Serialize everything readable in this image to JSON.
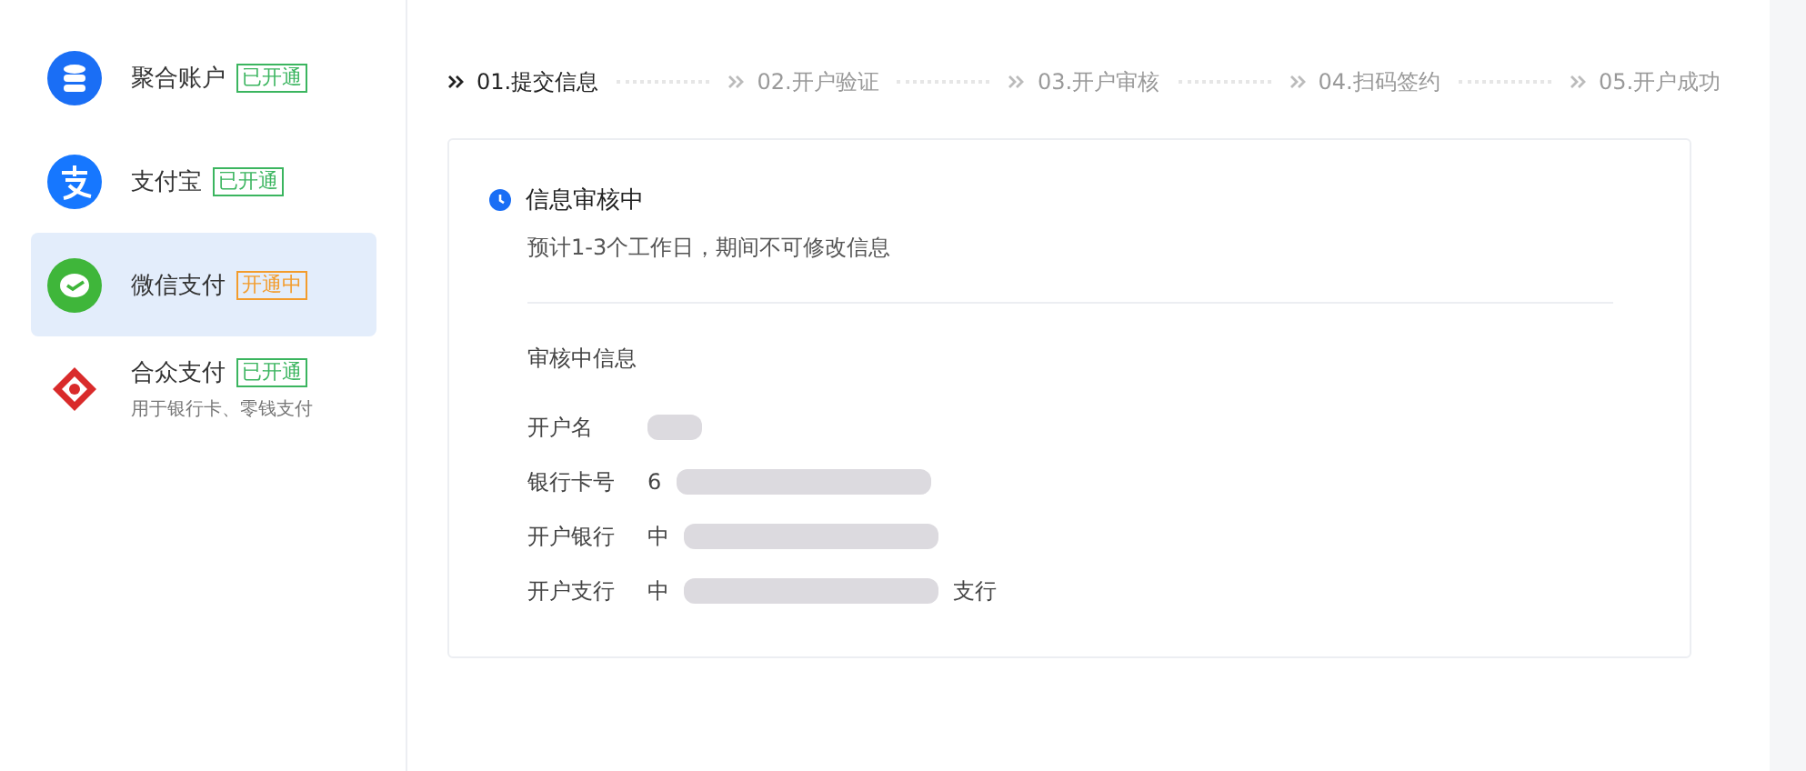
{
  "sidebar": {
    "items": [
      {
        "kind": "stack",
        "label": "聚合账户",
        "badge": "已开通",
        "color": "#3bb55f",
        "selected": false
      },
      {
        "kind": "alipay",
        "label": "支付宝",
        "badge": "已开通",
        "color": "#3bb55f",
        "selected": false
      },
      {
        "kind": "wechat",
        "label": "微信支付",
        "badge": "开通中",
        "color": "#f39c2c",
        "selected": true
      },
      {
        "kind": "bank",
        "label": "合众支付",
        "badge": "已开通",
        "color": "#3bb55f",
        "note": "用于银行卡、零钱支付",
        "selected": false
      }
    ]
  },
  "steps": [
    {
      "label": "01.提交信息",
      "selected": true
    },
    {
      "label": "02.开户验证",
      "selected": false
    },
    {
      "label": "03.开户审核",
      "selected": false
    },
    {
      "label": "04.扫码签约",
      "selected": false
    },
    {
      "label": "05.开户成功",
      "selected": false
    }
  ],
  "status": {
    "title": "信息审核中",
    "description": "预计1-3个工作日，期间不可修改信息"
  },
  "info": {
    "heading": "审核中信息",
    "fields": [
      {
        "label": "开户名",
        "redacted": true
      },
      {
        "label": "银行卡号",
        "value": "6",
        "redacted": true
      },
      {
        "label": "开户银行",
        "value": "中",
        "redacted": true
      },
      {
        "label": "开户支行",
        "value": "中",
        "suffix": "支行",
        "redacted": true
      }
    ]
  }
}
